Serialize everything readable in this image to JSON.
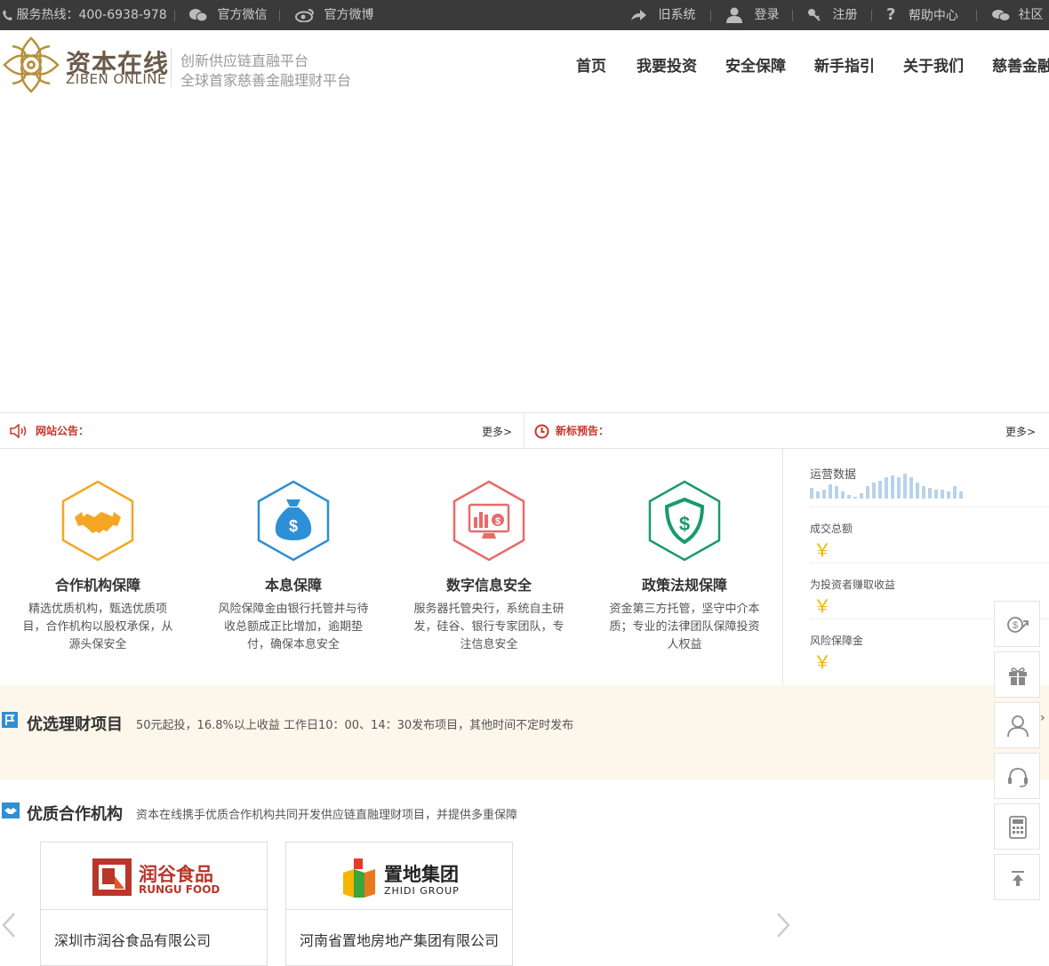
{
  "topbar": {
    "hotline": "服务热线：400-6938-978",
    "wechat": "官方微信",
    "weibo": "官方微博",
    "old_system": "旧系统",
    "login": "登录",
    "register": "注册",
    "help": "帮助中心",
    "community": "社区"
  },
  "header": {
    "brand_cn": "资本在线",
    "brand_en": "ZIBEN ONLINE",
    "slogan1": "创新供应链直融平台",
    "slogan2": "全球首家慈善金融理财平台",
    "nav": [
      "首页",
      "我要投资",
      "安全保障",
      "新手指引",
      "关于我们",
      "慈善金融"
    ]
  },
  "notices": {
    "site_label": "网站公告：",
    "new_label": "新标预告：",
    "more": "更多>"
  },
  "features": [
    {
      "title": "合作机构保障",
      "desc": "精选优质机构，甄选优质项目，合作机构以股权承保，从源头保安全"
    },
    {
      "title": "本息保障",
      "desc": "风险保障金由银行托管并与待收总额成正比增加，逾期垫付，确保本息安全"
    },
    {
      "title": "数字信息安全",
      "desc": "服务器托管央行，系统自主研发，硅谷、银行专家团队，专注信息安全"
    },
    {
      "title": "政策法规保障",
      "desc": "资金第三方托管，坚守中介本质；专业的法律团队保障投资人权益"
    }
  ],
  "stats": {
    "title": "运营数据",
    "total_deal": "成交总额",
    "earned": "为投资者赚取收益",
    "risk_fund": "风险保障金",
    "currency": "￥"
  },
  "products": {
    "title": "优选理财项目",
    "subtitle": "50元起投，16.8%以上收益 工作日10：00、14：30发布项目，其他时间不定时发布"
  },
  "partners": {
    "title": "优质合作机构",
    "subtitle": "资本在线携手优质合作机构共同开发供应链直融理财项目，并提供多重保障",
    "items": [
      {
        "logo_cn": "润谷食品",
        "logo_en": "RUNGU FOOD",
        "name": "深圳市润谷食品有限公司"
      },
      {
        "logo_cn": "置地集团",
        "logo_en": "ZHIDI GROUP",
        "name": "河南省置地房地产集团有限公司"
      }
    ]
  },
  "colors": {
    "topbar": "#3a3a3a",
    "accent_red": "#c8352b",
    "gold": "#f0b400",
    "orange": "#f5a623",
    "blue": "#2d8fd5",
    "pink": "#e86a6a",
    "green": "#1a9a6c"
  }
}
